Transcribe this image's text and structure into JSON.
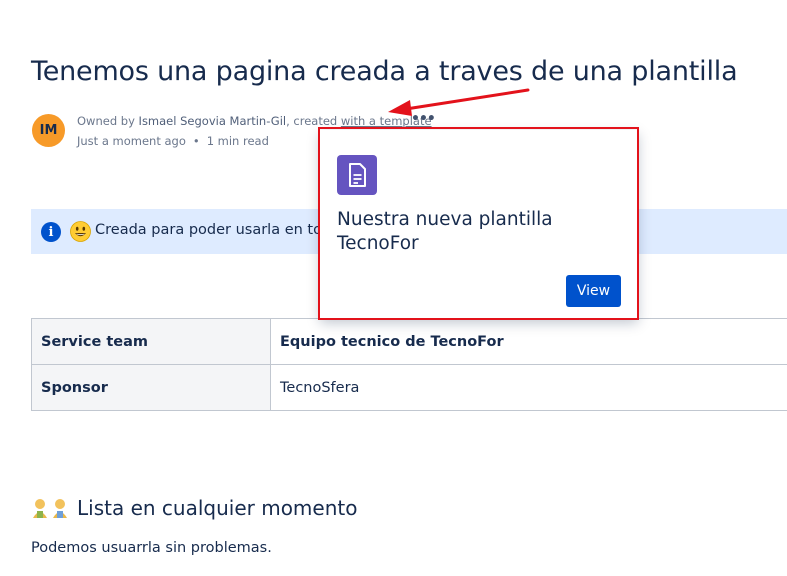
{
  "page": {
    "title": "Tenemos una pagina creada a traves de una plantilla",
    "avatar_initials": "IM",
    "byline": {
      "prefix": "Owned by ",
      "owner": "Ismael Segovia Martin-Gil",
      "middle": ", created ",
      "template_link": "with a template",
      "more_glyph": "•••"
    },
    "meta": {
      "time": "Just a moment ago",
      "separator": "•",
      "read_time": "1 min read"
    }
  },
  "info_panel": {
    "icon": "info-icon",
    "emoji": "smiley-icon",
    "text": "Creada para poder usarla en to"
  },
  "table": {
    "rows": [
      {
        "key": "Service team",
        "value": "Equipo tecnico de TecnoFor"
      },
      {
        "key": "Sponsor",
        "value": "TecnoSfera"
      }
    ]
  },
  "section": {
    "emoji": "people-icon",
    "heading": "Lista en cualquier momento",
    "body": "Podemos usuarrla sin problemas."
  },
  "popup": {
    "icon": "document-icon",
    "title": "Nuestra nueva plantilla TecnoFor",
    "button_label": "View"
  },
  "colors": {
    "annotation": "#e3121b",
    "accent": "#0052cc",
    "info_bg": "#deebff",
    "template_icon": "#6554c0",
    "avatar": "#f79a28"
  }
}
